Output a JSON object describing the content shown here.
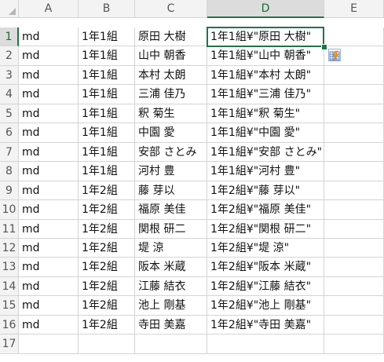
{
  "columns": [
    "A",
    "B",
    "C",
    "D",
    "E"
  ],
  "rows": [
    [
      "md",
      "1年1組",
      "原田 大樹",
      "1年1組¥\"原田 大樹\""
    ],
    [
      "md",
      "1年1組",
      "山中 朝香",
      "1年1組¥\"山中 朝香\""
    ],
    [
      "md",
      "1年1組",
      "本村 太朗",
      "1年1組¥\"本村 太朗\""
    ],
    [
      "md",
      "1年1組",
      "三浦 佳乃",
      "1年1組¥\"三浦 佳乃\""
    ],
    [
      "md",
      "1年1組",
      "釈 菊生",
      "1年1組¥\"釈 菊生\""
    ],
    [
      "md",
      "1年1組",
      "中園 愛",
      "1年1組¥\"中園 愛\""
    ],
    [
      "md",
      "1年1組",
      "安部 さとみ",
      "1年1組¥\"安部 さとみ\""
    ],
    [
      "md",
      "1年1組",
      "河村 豊",
      "1年1組¥\"河村 豊\""
    ],
    [
      "md",
      "1年2組",
      "藤 芽以",
      "1年2組¥\"藤 芽以\""
    ],
    [
      "md",
      "1年2組",
      "福原 美佳",
      "1年2組¥\"福原 美佳\""
    ],
    [
      "md",
      "1年2組",
      "関根 研二",
      "1年2組¥\"関根 研二\""
    ],
    [
      "md",
      "1年2組",
      "堤 涼",
      "1年2組¥\"堤 涼\""
    ],
    [
      "md",
      "1年2組",
      "阪本 米蔵",
      "1年2組¥\"阪本 米蔵\""
    ],
    [
      "md",
      "1年2組",
      "江藤 結衣",
      "1年2組¥\"江藤 結衣\""
    ],
    [
      "md",
      "1年2組",
      "池上 剛基",
      "1年2組¥\"池上 剛基\""
    ],
    [
      "md",
      "1年2組",
      "寺田 美嘉",
      "1年2組¥\"寺田 美嘉\""
    ],
    [
      "",
      "",
      "",
      ""
    ]
  ],
  "row_numbers": [
    "1",
    "2",
    "3",
    "4",
    "5",
    "6",
    "7",
    "8",
    "9",
    "10",
    "11",
    "12",
    "13",
    "14",
    "15",
    "16",
    "17"
  ],
  "selection": {
    "cell": "D1",
    "accent": "#217346"
  },
  "icons": {
    "autofill_options": "autofill-options-icon"
  }
}
